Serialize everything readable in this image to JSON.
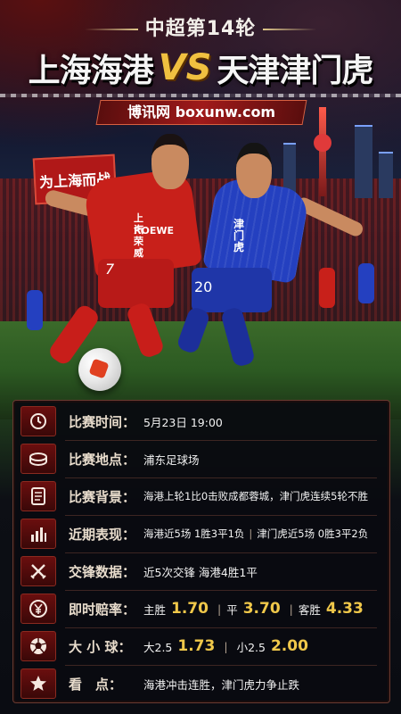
{
  "header": {
    "round": "中超第14轮",
    "home_team": "上海海港",
    "vs": "VS",
    "away_team": "天津津门虎",
    "site": "博讯网 boxunw.com"
  },
  "scene": {
    "banner_text": "为上海而战",
    "home_jersey_sponsor_1": "上汽荣威",
    "home_jersey_sponsor_2": "ROEWE",
    "home_number": "7",
    "away_jersey_text": "津门虎",
    "away_number": "20"
  },
  "info": {
    "time_label": "比赛时间：",
    "time_value": "5月23日 19:00",
    "venue_label": "比赛地点：",
    "venue_value": "浦东足球场",
    "background_label": "比赛背景：",
    "background_value": "海港上轮1比0击败成都蓉城，津门虎连续5轮不胜",
    "form_label": "近期表现：",
    "form_home": "海港近5场 1胜3平1负",
    "form_sep": "|",
    "form_away": "津门虎近5场 0胜3平2负",
    "h2h_label": "交锋数据：",
    "h2h_value": "近5次交锋 海港4胜1平",
    "odds_label": "即时赔率：",
    "odds_home_label": "主胜",
    "odds_home": "1.70",
    "odds_draw_label": "平",
    "odds_draw": "3.70",
    "odds_away_label": "客胜",
    "odds_away": "4.33",
    "ou_label": "大 小 球：",
    "ou_over_label": "大2.5",
    "ou_over": "1.73",
    "ou_under_label": "小2.5",
    "ou_under": "2.00",
    "highlight_label": "看　点：",
    "highlight_value": "海港冲击连胜，津门虎力争止跌",
    "sep": "|"
  },
  "icons": {
    "time": "clock-icon",
    "venue": "stadium-icon",
    "background": "document-icon",
    "form": "bar-chart-icon",
    "h2h": "crossed-swords-icon",
    "odds": "yen-icon",
    "ou": "soccer-ball-icon",
    "highlight": "star-icon"
  },
  "colors": {
    "accent_gold": "#f0c84a",
    "home_red": "#c8201a",
    "away_blue": "#2440c0"
  }
}
